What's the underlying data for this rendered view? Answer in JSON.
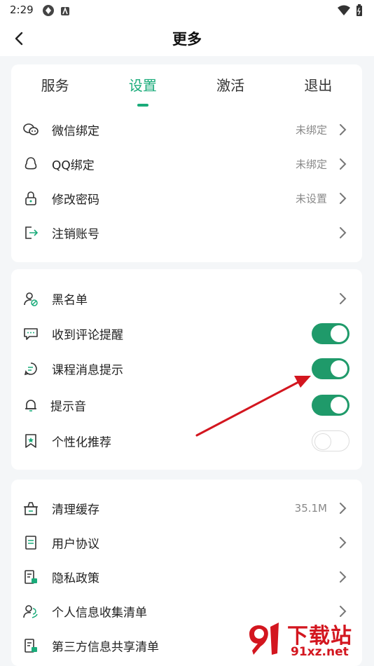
{
  "status_bar": {
    "time": "2:29"
  },
  "header": {
    "title": "更多"
  },
  "tabs": [
    {
      "label": "服务",
      "active": false
    },
    {
      "label": "设置",
      "active": true
    },
    {
      "label": "激活",
      "active": false
    },
    {
      "label": "退出",
      "active": false
    }
  ],
  "account_section": [
    {
      "label": "微信绑定",
      "value": "未绑定",
      "icon": "wechat-icon"
    },
    {
      "label": "QQ绑定",
      "value": "未绑定",
      "icon": "qq-icon"
    },
    {
      "label": "修改密码",
      "value": "未设置",
      "icon": "lock-icon"
    },
    {
      "label": "注销账号",
      "value": "",
      "icon": "logout-icon"
    }
  ],
  "settings_section": [
    {
      "label": "黑名单",
      "type": "link",
      "icon": "blacklist-icon"
    },
    {
      "label": "收到评论提醒",
      "type": "toggle",
      "on": true,
      "icon": "comment-icon"
    },
    {
      "label": "课程消息提示",
      "type": "toggle",
      "on": true,
      "icon": "message-icon"
    },
    {
      "label": "提示音",
      "type": "toggle",
      "on": true,
      "icon": "bell-icon"
    },
    {
      "label": "个性化推荐",
      "type": "toggle",
      "on": false,
      "icon": "bookmark-star-icon"
    }
  ],
  "misc_section": [
    {
      "label": "清理缓存",
      "value": "35.1M",
      "icon": "cache-icon"
    },
    {
      "label": "用户协议",
      "value": "",
      "icon": "document-icon"
    },
    {
      "label": "隐私政策",
      "value": "",
      "icon": "privacy-icon"
    },
    {
      "label": "个人信息收集清单",
      "value": "",
      "icon": "person-list-icon"
    },
    {
      "label": "第三方信息共享清单",
      "value": "",
      "icon": "share-list-icon"
    }
  ],
  "watermark": {
    "title": "下载站",
    "domain": "91xz.net"
  },
  "colors": {
    "accent": "#1aab7a",
    "toggle_on": "#1f9a6a",
    "annotation_arrow": "#d3161f"
  }
}
